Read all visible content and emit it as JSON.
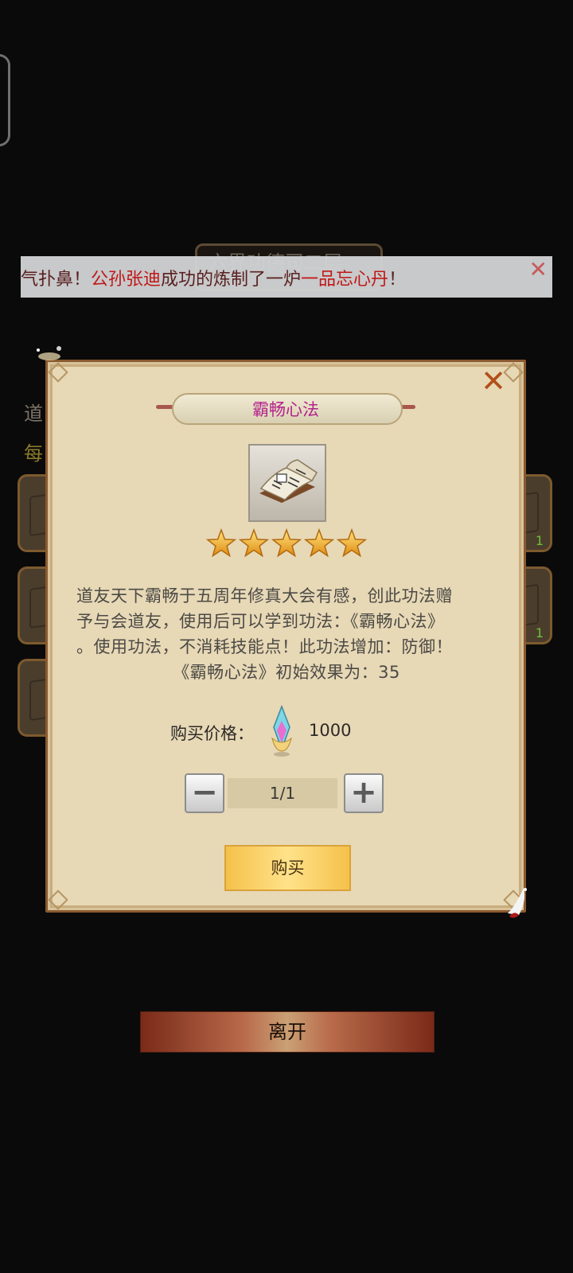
{
  "background": {
    "title": "六界功德司二层",
    "text_a": "道",
    "text_b": "每",
    "card_quantities": [
      "1",
      "1"
    ]
  },
  "marquee": {
    "parts": [
      {
        "text": "气扑鼻！",
        "style": "plain"
      },
      {
        "text": "公孙张迪",
        "style": "red"
      },
      {
        "text": "成功的炼制了一炉",
        "style": "plain"
      },
      {
        "text": "一品忘心丹",
        "style": "red"
      },
      {
        "text": "！",
        "style": "plain"
      }
    ],
    "close_icon": "close-x-icon"
  },
  "dialog": {
    "title": "霸畅心法",
    "close_icon": "close-x-icon",
    "item_icon": "book-scroll-icon",
    "star_rating": 5,
    "description_lines": [
      "道友天下霸畅于五周年修真大会有感，创此功法赠",
      "予与会道友，使用后可以学到功法：《霸畅心法》",
      "。使用功法，不消耗技能点！此功法增加：防御！",
      "《霸畅心法》初始效果为：35"
    ],
    "price_label": "购买价格：",
    "price_currency_icon": "crystal-gem-icon",
    "price_value": "1000",
    "quantity": "1/1",
    "minus_label": "−",
    "plus_label": "+",
    "buy_label": "购买"
  },
  "footer": {
    "leave_label": "离开"
  },
  "colors": {
    "accent_title": "#b2238c",
    "marquee_highlight": "#c01818",
    "buy_gold": "#ffe28a",
    "panel_parchment": "#e7d8b6"
  }
}
